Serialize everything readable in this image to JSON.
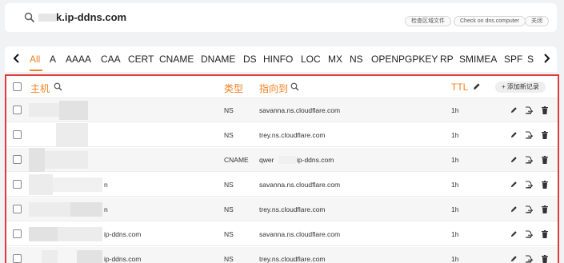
{
  "header": {
    "domain": "k.ip-ddns.com",
    "buttons": [
      "检查区域文件",
      "Check on dns.computer",
      "关闭"
    ]
  },
  "tabs": [
    "All",
    "A",
    "AAAA",
    "CAA",
    "CERT",
    "CNAME",
    "DNAME",
    "DS",
    "HINFO",
    "LOC",
    "MX",
    "NS",
    "OPENPGPKEY",
    "RP",
    "SMIMEA",
    "SPF",
    "S"
  ],
  "active_tab": "All",
  "table": {
    "headers": {
      "host": "主机",
      "type": "类型",
      "points_to": "指向到",
      "ttl": "TTL",
      "add": "+ 添加新记录"
    },
    "rows": [
      {
        "host": "",
        "type": "NS",
        "value": "savanna.ns.cloudflare.com",
        "ttl": "1h"
      },
      {
        "host": "",
        "type": "NS",
        "value": "trey.ns.cloudflare.com",
        "ttl": "1h"
      },
      {
        "host": "",
        "type": "CNAME",
        "value": "qwer",
        "value_suffix": "ip-ddns.com",
        "ttl": "1h"
      },
      {
        "host": "n",
        "type": "NS",
        "value": "savanna.ns.cloudflare.com",
        "ttl": "1h"
      },
      {
        "host": "n",
        "type": "NS",
        "value": "trey.ns.cloudflare.com",
        "ttl": "1h"
      },
      {
        "host": "ip-ddns.com",
        "type": "NS",
        "value": "savanna.ns.cloudflare.com",
        "ttl": "1h"
      },
      {
        "host": "ip-ddns.com",
        "type": "NS",
        "value": "trey.ns.cloudflare.com",
        "ttl": "1h"
      }
    ]
  },
  "colors": {
    "accent": "#f38020",
    "highlight_border": "#e03c3c"
  },
  "icons": [
    "search-icon",
    "chevron-left-icon",
    "chevron-right-icon",
    "pencil-icon",
    "export-icon",
    "trash-icon"
  ]
}
